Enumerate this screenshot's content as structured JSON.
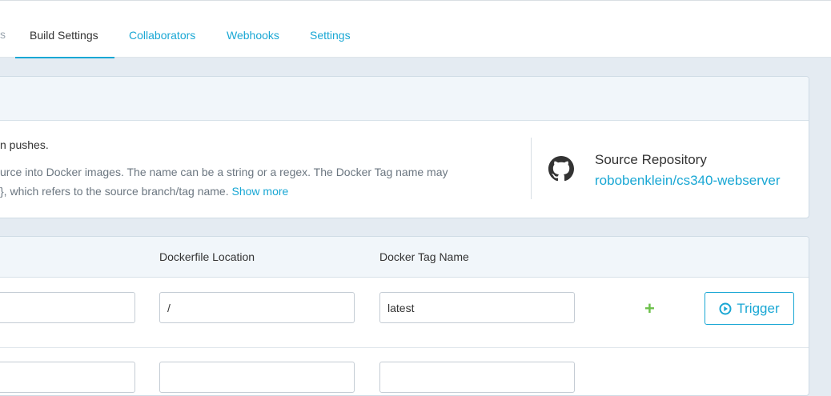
{
  "tabs": [
    {
      "label": "Build Settings",
      "active": true
    },
    {
      "label": "Collaborators",
      "active": false
    },
    {
      "label": "Webhooks",
      "active": false
    },
    {
      "label": "Settings",
      "active": false
    }
  ],
  "tab_edge_glyph": "s",
  "info": {
    "line1": "n pushes.",
    "line2": "urce into Docker images. The name can be a string or a regex. The Docker Tag name may",
    "line3": "}, which refers to the source branch/tag name.",
    "show_more": "Show more"
  },
  "repo": {
    "label": "Source Repository",
    "link": "robobenklein/cs340-webserver",
    "icon": "github-icon"
  },
  "build_rules": {
    "headers": {
      "dockerfile_location": "Dockerfile Location",
      "docker_tag_name": "Docker Tag Name"
    },
    "row": {
      "source_value": "",
      "dockerfile_location": "/",
      "docker_tag_name": "latest"
    },
    "add_icon": "plus-icon",
    "trigger_label": "Trigger"
  },
  "colors": {
    "accent": "#19a7d4",
    "add_green": "#6cc04a",
    "page_bg": "#e4ebf2"
  }
}
